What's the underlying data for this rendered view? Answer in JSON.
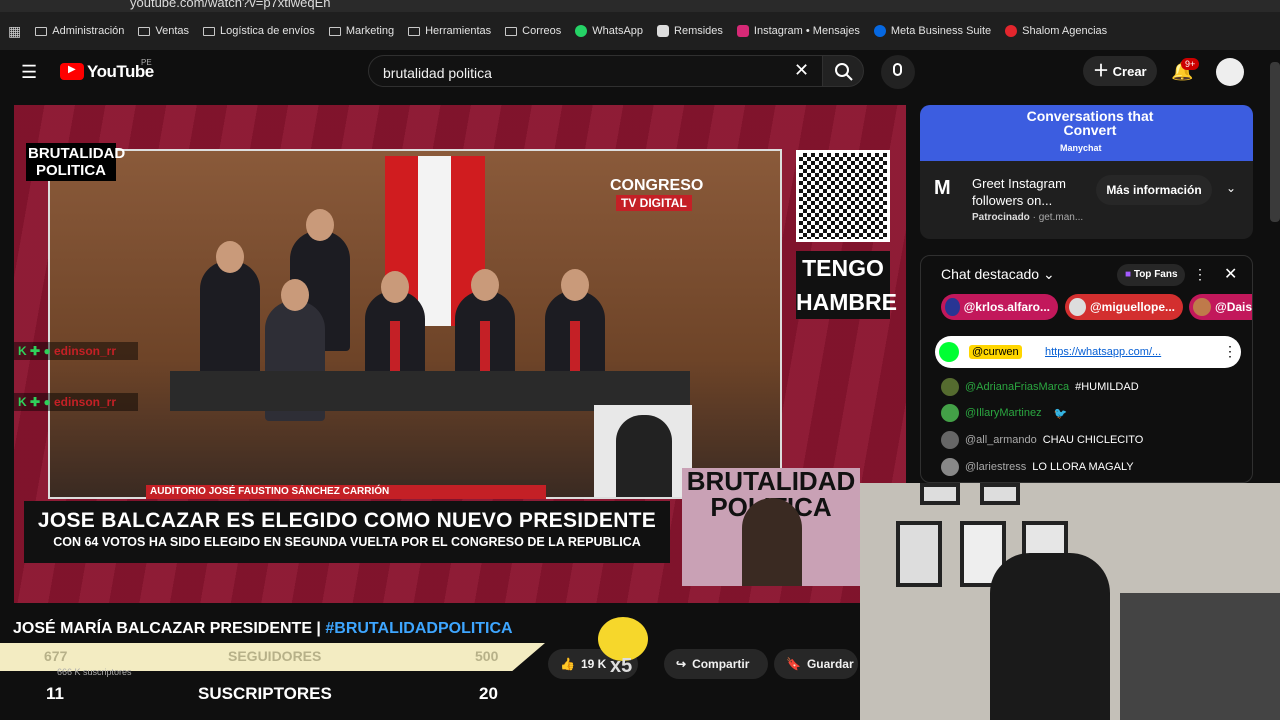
{
  "browser": {
    "url": "youtube.com/watch?v=p7xtiweqEh",
    "bookmarks": [
      "Administración",
      "Ventas",
      "Logística de envíos",
      "Marketing",
      "Herramientas",
      "Correos",
      "WhatsApp",
      "Remsides",
      "Instagram • Mensajes",
      "Meta Business Suite",
      "Shalom Agencias"
    ]
  },
  "header": {
    "brand": "YouTube",
    "region": "PE",
    "search_value": "brutalidad politica",
    "create_label": "Crear",
    "notif_count": "9+"
  },
  "video": {
    "logo_text": "BRUTALIDAD POLITICA",
    "channel_label": "CONGRESO",
    "channel_sub": "TV DIGITAL",
    "auditorium": "AUDITORIO JOSÉ FAUSTINO SÁNCHEZ CARRIÓN",
    "side_text": "TENGO HAMBRE",
    "chat_user_1": "edinson_rr",
    "chat_user_2": "edinson_rr",
    "headline": "JOSE BALCAZAR ES ELEGIDO COMO NUEVO PRESIDENTE",
    "subheadline": "CON 64 VOTOS HA SIDO ELEGIDO EN SEGUNDA VUELTA POR EL CONGRESO DE LA REPUBLICA",
    "cam_text": "BRUTALIDAD POLITICA"
  },
  "below": {
    "title_main": "JOSÉ MARÍA BALCAZAR PRESIDENTE | ",
    "title_tag": "#BRUTALIDADPOLITICA",
    "followers_current": "677",
    "followers_label": "SEGUIDORES",
    "followers_goal": "500",
    "subs_small": "666 K suscriptores",
    "subs_current": "11",
    "subs_label": "SUSCRIPTORES",
    "subs_goal": "20",
    "likes": "19 K",
    "multiplier": "x5",
    "share_label": "Compartir",
    "save_label": "Guardar"
  },
  "ad": {
    "banner_title": "Conversations that Convert",
    "banner_brand": "Manychat",
    "headline": "Greet Instagram followers on...",
    "sponsored": "Patrocinado",
    "domain": "get.man...",
    "cta": "Más información"
  },
  "chat": {
    "title": "Chat destacado",
    "top_fans": "Top Fans",
    "chips": [
      "@krlos.alfaro...",
      "@miguellope...",
      "@Daisa"
    ],
    "pinned_user": "@curwen",
    "pinned_link": "https://whatsapp.com/...",
    "messages": [
      {
        "user": "@AdrianaFriasMarca",
        "text": "#HUMILDAD"
      },
      {
        "user": "@IllaryMartinez",
        "text": ""
      },
      {
        "user": "@all_armando",
        "text": "CHAU CHICLECITO"
      },
      {
        "user": "@lariestress",
        "text": "LO LLORA MAGALY"
      }
    ]
  },
  "colors": {
    "accent": "#3ea6ff",
    "brand_red": "#ff0000",
    "video_bg": "#8b1530",
    "bar": "#f3ecc2"
  }
}
